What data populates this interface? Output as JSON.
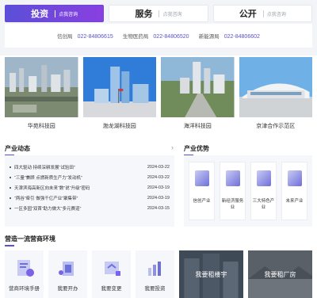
{
  "tabs": [
    {
      "label": "投资",
      "sub": "点我咨询",
      "active": true
    },
    {
      "label": "服务",
      "sub": "点我咨询",
      "active": false
    },
    {
      "label": "公开",
      "sub": "点我咨询",
      "active": false
    }
  ],
  "phones": [
    {
      "name": "信创局",
      "num": "022-84806615"
    },
    {
      "name": "生物医药局",
      "num": "022-84806520"
    },
    {
      "name": "新能源局",
      "num": "022-84806602"
    }
  ],
  "parks": [
    {
      "name": "华苑科技园"
    },
    {
      "name": "渤龙湖科技园"
    },
    {
      "name": "海洋科技园"
    },
    {
      "name": "京津合作示范区"
    }
  ],
  "news": {
    "title": "产业动态",
    "items": [
      {
        "text": "四大驱动 持续深耕发展“试验田”",
        "date": "2024-03-22"
      },
      {
        "text": "“三量”兼顾 点燃新质生产力“发动机”",
        "date": "2024-03-22"
      },
      {
        "text": "天津滨海高新区向未来“数”说“升级”密码",
        "date": "2024-03-19"
      },
      {
        "text": "“两谷”牵引 做强千亿产业“聚集带”",
        "date": "2024-03-19"
      },
      {
        "text": "一区多园“双首”助力做大“多元赛道”",
        "date": "2024-03-15"
      }
    ]
  },
  "advantages": {
    "title": "产业优势",
    "items": [
      {
        "label": "信创产业"
      },
      {
        "label": "新经济服务业"
      },
      {
        "label": "三大特色产业"
      },
      {
        "label": "未来产业"
      }
    ]
  },
  "env": {
    "title": "营造一流营商环境",
    "items": [
      {
        "label": "营商环境手册"
      },
      {
        "label": "我要开办"
      },
      {
        "label": "我要变更"
      },
      {
        "label": "我要投资"
      }
    ],
    "photos": [
      {
        "label": "我要租楼宇"
      },
      {
        "label": "我要租厂房"
      }
    ]
  },
  "colors": {
    "accent": "#5b4fd8",
    "phone": "#5b53c9"
  }
}
